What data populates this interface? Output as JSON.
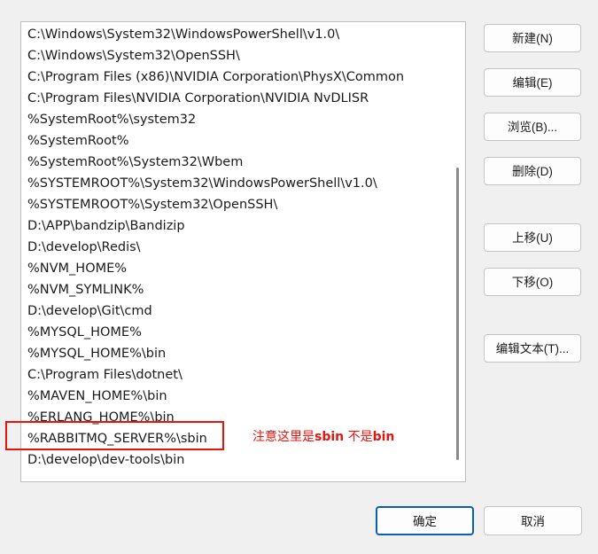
{
  "path_list": {
    "items": [
      "C:\\Windows\\System32\\WindowsPowerShell\\v1.0\\",
      "C:\\Windows\\System32\\OpenSSH\\",
      "C:\\Program Files (x86)\\NVIDIA Corporation\\PhysX\\Common",
      "C:\\Program Files\\NVIDIA Corporation\\NVIDIA NvDLISR",
      "%SystemRoot%\\system32",
      "%SystemRoot%",
      "%SystemRoot%\\System32\\Wbem",
      "%SYSTEMROOT%\\System32\\WindowsPowerShell\\v1.0\\",
      "%SYSTEMROOT%\\System32\\OpenSSH\\",
      "D:\\APP\\bandzip\\Bandizip",
      "D:\\develop\\Redis\\",
      "%NVM_HOME%",
      "%NVM_SYMLINK%",
      "D:\\develop\\Git\\cmd",
      "%MYSQL_HOME%",
      "%MYSQL_HOME%\\bin",
      "C:\\Program Files\\dotnet\\",
      "%MAVEN_HOME%\\bin",
      "%ERLANG_HOME%\\bin",
      "%RABBITMQ_SERVER%\\sbin",
      "D:\\develop\\dev-tools\\bin"
    ]
  },
  "annotation": {
    "part1": "注意这里是",
    "part2": "sbin",
    "part3": " 不是",
    "part4": "bin"
  },
  "buttons": {
    "new": "新建(N)",
    "edit": "编辑(E)",
    "browse": "浏览(B)...",
    "delete": "删除(D)",
    "move_up": "上移(U)",
    "move_down": "下移(O)",
    "edit_text": "编辑文本(T)...",
    "ok": "确定",
    "cancel": "取消"
  },
  "colors": {
    "highlight": "#e8140c",
    "ok_border": "#0a5fb4"
  }
}
